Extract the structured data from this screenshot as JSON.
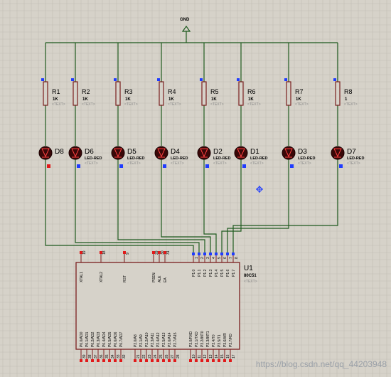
{
  "gnd_label": "GND",
  "resistors": [
    {
      "ref": "R1",
      "value": "1K",
      "text": "<TEXT>"
    },
    {
      "ref": "R2",
      "value": "1K",
      "text": "<TEXT>"
    },
    {
      "ref": "R3",
      "value": "1K",
      "text": "<TEXT>"
    },
    {
      "ref": "R4",
      "value": "1K",
      "text": "<TEXT>"
    },
    {
      "ref": "R5",
      "value": "1K",
      "text": "<TEXT>"
    },
    {
      "ref": "R6",
      "value": "1K",
      "text": "<TEXT>"
    },
    {
      "ref": "R7",
      "value": "1K",
      "text": "<TEXT>"
    },
    {
      "ref": "R8",
      "value": "1",
      "text": "<TEXT>"
    }
  ],
  "leds": [
    {
      "ref": "D8",
      "type": "",
      "text": ""
    },
    {
      "ref": "D6",
      "type": "LED-RED",
      "text": "<TEXT>"
    },
    {
      "ref": "D5",
      "type": "LED-RED",
      "text": "<TEXT>"
    },
    {
      "ref": "D4",
      "type": "LED-RED",
      "text": "<TEXT>"
    },
    {
      "ref": "D2",
      "type": "LED-RED",
      "text": "<TEXT>"
    },
    {
      "ref": "D1",
      "type": "LED-RED",
      "text": "<TEXT>"
    },
    {
      "ref": "D3",
      "type": "LED-RED",
      "text": "<TEXT>"
    },
    {
      "ref": "D7",
      "type": "LED-RED",
      "text": "<TEXT>"
    }
  ],
  "chip": {
    "ref": "U1",
    "part": "80C51",
    "text": "<TEXT>",
    "top_left_pins": [
      {
        "num": "19",
        "label": "XTAL1"
      },
      {
        "num": "18",
        "label": "XTAL2"
      },
      {
        "num": "9",
        "label": "RST"
      },
      {
        "num": "29",
        "label": "PSEN"
      },
      {
        "num": "30",
        "label": "ALE"
      },
      {
        "num": "31",
        "label": "EA"
      }
    ],
    "p1_pins": [
      {
        "num": "1",
        "label": "P1.0"
      },
      {
        "num": "2",
        "label": "P1.1"
      },
      {
        "num": "3",
        "label": "P1.2"
      },
      {
        "num": "4",
        "label": "P1.3"
      },
      {
        "num": "5",
        "label": "P1.4"
      },
      {
        "num": "6",
        "label": "P1.5"
      },
      {
        "num": "7",
        "label": "P1.6"
      },
      {
        "num": "8",
        "label": "P1.7"
      }
    ],
    "p0_pins": [
      {
        "num": "39",
        "label": "P0.0/AD0"
      },
      {
        "num": "38",
        "label": "P0.1/AD1"
      },
      {
        "num": "37",
        "label": "P0.2/AD2"
      },
      {
        "num": "36",
        "label": "P0.3/AD3"
      },
      {
        "num": "35",
        "label": "P0.4/AD4"
      },
      {
        "num": "34",
        "label": "P0.5/AD5"
      },
      {
        "num": "33",
        "label": "P0.6/AD6"
      },
      {
        "num": "32",
        "label": "P0.7/AD7"
      }
    ],
    "p2_pins": [
      {
        "num": "21",
        "label": "P2.0/A8"
      },
      {
        "num": "22",
        "label": "P2.1/A9"
      },
      {
        "num": "23",
        "label": "P2.2/A10"
      },
      {
        "num": "24",
        "label": "P2.3/A11"
      },
      {
        "num": "25",
        "label": "P2.4/A12"
      },
      {
        "num": "26",
        "label": "P2.5/A13"
      },
      {
        "num": "27",
        "label": "P2.6/A14"
      },
      {
        "num": "28",
        "label": "P2.7/A15"
      }
    ],
    "p3_pins": [
      {
        "num": "10",
        "label": "P3.0/RXD"
      },
      {
        "num": "11",
        "label": "P3.1/TXD"
      },
      {
        "num": "12",
        "label": "P3.2/INT0"
      },
      {
        "num": "13",
        "label": "P3.3/INT1"
      },
      {
        "num": "14",
        "label": "P3.4/T0"
      },
      {
        "num": "15",
        "label": "P3.5/T1"
      },
      {
        "num": "16",
        "label": "P3.6/WR"
      },
      {
        "num": "17",
        "label": "P3.7/RD"
      }
    ]
  },
  "watermark": "https://blog.csdn.net/qq_44203948",
  "colors": {
    "background": "#d6d2c9",
    "grid": "#c2beb5",
    "wire": "#1e5a1e",
    "component": "#7a1e1e",
    "led_fill": "#3a0808",
    "pin_blue": "#1f3cff",
    "pin_red": "#e11a1a"
  }
}
